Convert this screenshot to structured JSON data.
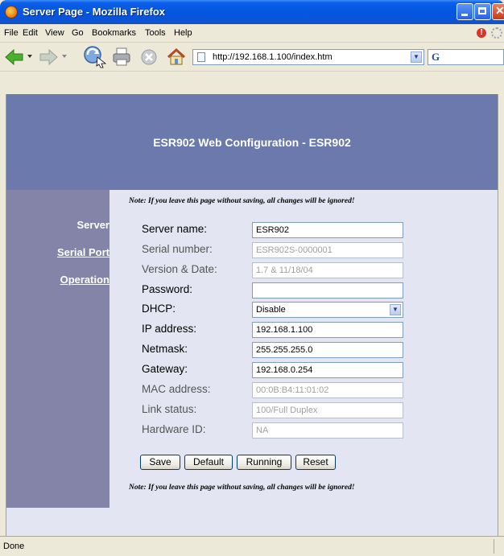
{
  "window": {
    "title": "Server Page - Mozilla Firefox"
  },
  "menu": {
    "items": [
      "File",
      "Edit",
      "View",
      "Go",
      "Bookmarks",
      "Tools",
      "Help"
    ]
  },
  "toolbar": {
    "url": "http://192.168.1.100/index.htm",
    "search_engine_glyph": "G"
  },
  "page": {
    "header_title": "ESR902 Web Configuration - ESR902",
    "sidebar": {
      "items": [
        {
          "label": "Server",
          "link": false
        },
        {
          "label": "Serial Port",
          "link": true
        },
        {
          "label": "Operation",
          "link": true
        }
      ]
    },
    "note_top": "Note: If you leave this page without saving, all changes will be ignored!",
    "note_bottom": "Note: If you leave this page without saving, all changes will be ignored!",
    "fields": [
      {
        "label": "Server name:",
        "value": "ESR902",
        "readonly": false
      },
      {
        "label": "Serial number:",
        "value": "ESR902S-0000001",
        "readonly": true
      },
      {
        "label": "Version & Date:",
        "value": "1.7 & 11/18/04",
        "readonly": true
      },
      {
        "label": "Password:",
        "value": "",
        "readonly": false
      },
      {
        "label": "DHCP:",
        "value": "Disable",
        "readonly": false,
        "type": "select"
      },
      {
        "label": "IP address:",
        "value": "192.168.1.100",
        "readonly": false
      },
      {
        "label": "Netmask:",
        "value": "255.255.255.0",
        "readonly": false
      },
      {
        "label": "Gateway:",
        "value": "192.168.0.254",
        "readonly": false
      },
      {
        "label": "MAC address:",
        "value": "00:0B:B4:11:01:02",
        "readonly": true
      },
      {
        "label": "Link status:",
        "value": "100/Full Duplex",
        "readonly": true
      },
      {
        "label": "Hardware ID:",
        "value": "NA",
        "readonly": true
      }
    ],
    "buttons": {
      "save": "Save",
      "default": "Default",
      "running": "Running",
      "reset": "Reset"
    }
  },
  "status": {
    "text": "Done"
  }
}
